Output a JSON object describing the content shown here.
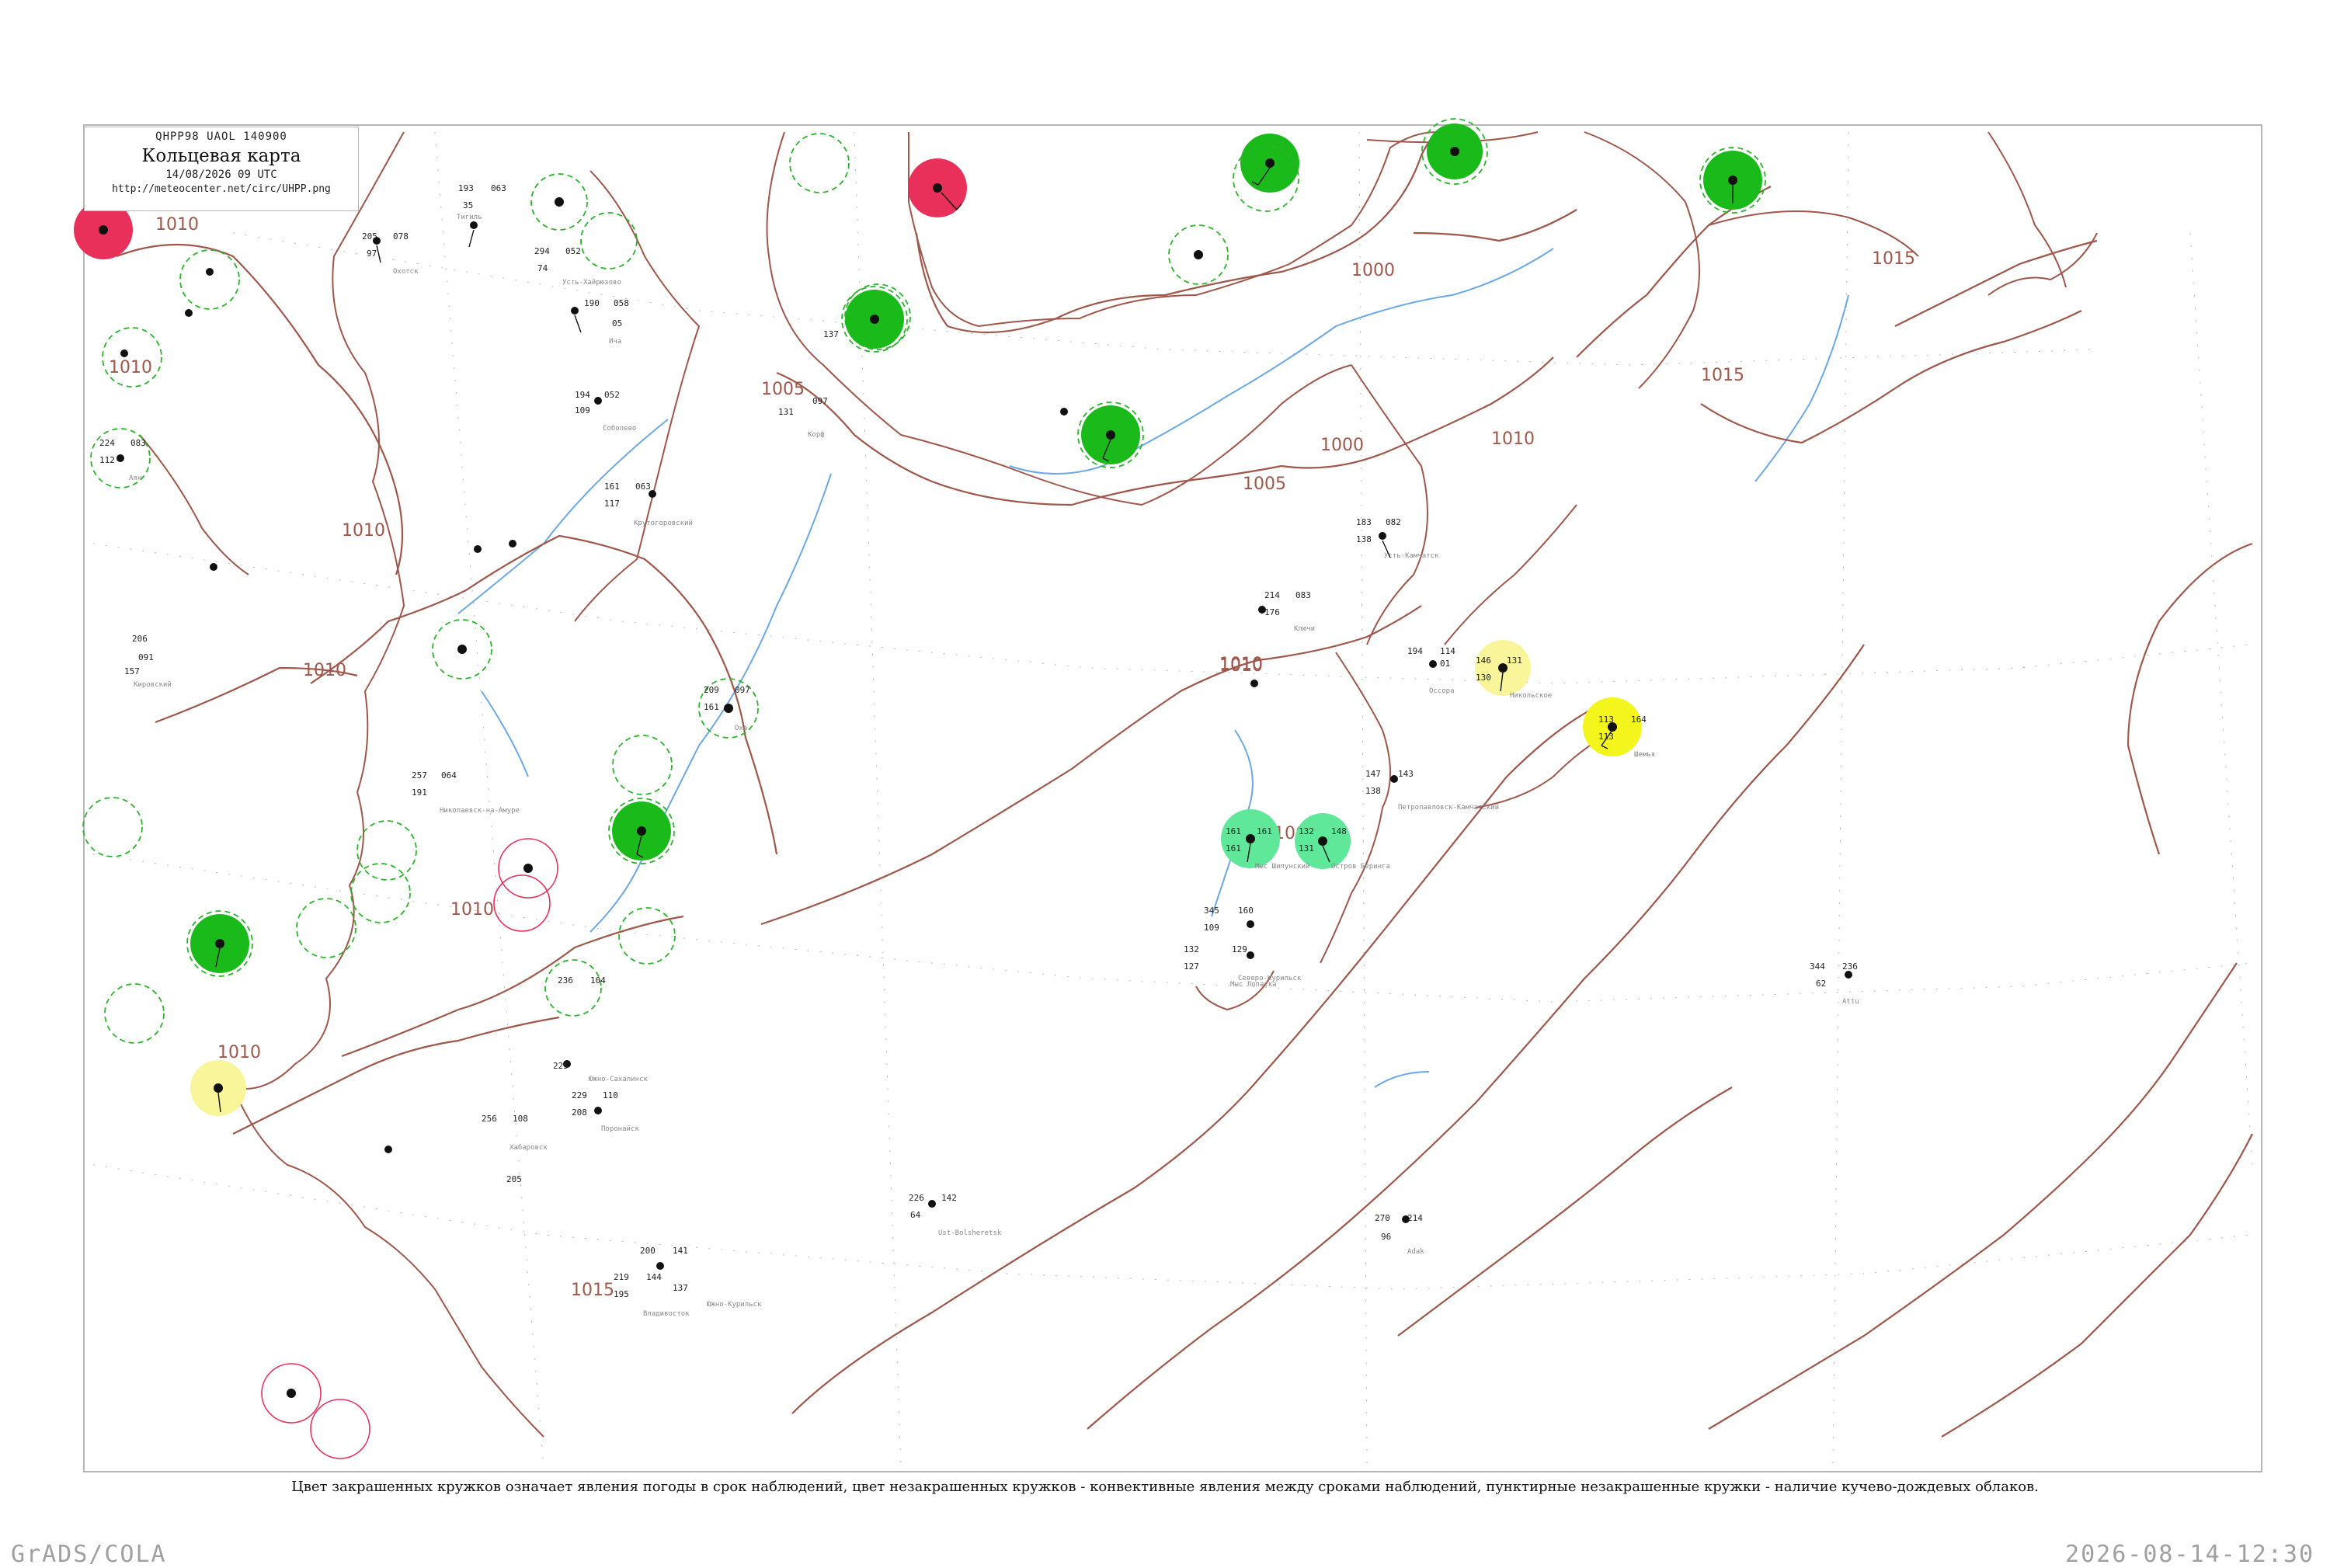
{
  "legend": {
    "code": "QHPP98  UAOL  140900",
    "title": "Кольцевая карта",
    "datetime": "14/08/2026 09 UTC",
    "url": "http://meteocenter.net/circ/UHPP.png"
  },
  "caption": "Цвет закрашенных кружков означает явления погоды в срок наблюдений, цвет незакрашенных кружков - конвективные явления между сроками наблюдений, пунктирные незакрашенные кружки - наличие кучево-дождевых облаков.",
  "footer": {
    "left": "GrADS/COLA",
    "right": "2026-08-14-12:30"
  },
  "colors": {
    "isobar": "#a0574a",
    "river": "#6aa8e8",
    "frame": "#b5b5b5",
    "rain": "#1aba1a",
    "shower_light": "#5fe89a",
    "thunder": "#e8305a",
    "fog": "#f5f51e",
    "fog_light": "#f8f59a",
    "cb_dashed": "#2ab52a"
  },
  "isobar_labels": [
    "1010",
    "1010",
    "1010",
    "1010",
    "1010",
    "1010",
    "1010",
    "1005",
    "1000",
    "1005",
    "1000",
    "1015",
    "1015",
    "1010",
    "1010",
    "1015",
    "1005"
  ],
  "stations": [
    {
      "name": "Тигиль",
      "pressure": "063",
      "temp": "193",
      "code": "35"
    },
    {
      "name": "Усть-Хайрюзово",
      "pressure": "052",
      "temp": "294",
      "code": "74"
    },
    {
      "name": "Ича",
      "pressure": "058",
      "temp": "190",
      "code": "05"
    },
    {
      "name": "Соболево",
      "pressure": "052",
      "temp": "194",
      "code": "109"
    },
    {
      "name": "Крутогоровский",
      "pressure": "063",
      "temp": "161",
      "code": "117"
    },
    {
      "name": "Охотск",
      "pressure": "078",
      "temp": "205",
      "code": "97"
    },
    {
      "name": "Аян",
      "pressure": "083",
      "temp": "224",
      "code": "112"
    },
    {
      "name": "Николаевск-на-Амуре",
      "pressure": "064",
      "temp": "257",
      "code": "191"
    },
    {
      "name": "Усть-Камчатск",
      "pressure": "082",
      "temp": "183",
      "code": "138"
    },
    {
      "name": "Ключи",
      "pressure": "083",
      "temp": "214",
      "code": "176"
    },
    {
      "name": "Петропавловск-Камчатский",
      "pressure": "143",
      "temp": "147",
      "code": "138"
    },
    {
      "name": "Северо-Курильск",
      "pressure": "160",
      "temp": "345",
      "code": "109"
    },
    {
      "name": "Южно-Курильск",
      "pressure": "141",
      "temp": "200",
      "code": "137"
    },
    {
      "name": "Корф",
      "pressure": "097",
      "temp": "137",
      "code": "131"
    },
    {
      "name": "Оссора",
      "pressure": "114",
      "temp": "194",
      "code": "01"
    },
    {
      "name": "Никольское",
      "pressure": "131",
      "temp": "146",
      "code": "130"
    },
    {
      "name": "Шемья",
      "pressure": "164",
      "temp": "113",
      "code": "113"
    },
    {
      "name": "Хабаровск",
      "pressure": "108",
      "temp": "256",
      "code": "205"
    },
    {
      "name": "Владивосток",
      "pressure": "144",
      "temp": "219",
      "code": "195"
    },
    {
      "name": "Южно-Сахалинск",
      "pressure": "104",
      "temp": "236",
      "code": "225"
    },
    {
      "name": "Поронайск",
      "pressure": "110",
      "temp": "229",
      "code": "208"
    },
    {
      "name": "Оха",
      "pressure": "097",
      "temp": "209",
      "code": "161"
    },
    {
      "name": "Мыс Лопатка",
      "pressure": "129",
      "temp": "132",
      "code": "127"
    },
    {
      "name": "Остров Беринга",
      "pressure": "148",
      "temp": "132",
      "code": "131"
    },
    {
      "name": "Мыс Шипунский",
      "pressure": "161",
      "temp": "161",
      "code": "161"
    },
    {
      "name": "Attu",
      "pressure": "236",
      "temp": "344",
      "code": "62"
    },
    {
      "name": "Adak",
      "pressure": "214",
      "temp": "270",
      "code": "96"
    },
    {
      "name": "Ust-Bolsheretsk",
      "pressure": "142",
      "temp": "226",
      "code": "64"
    },
    {
      "name": "Кировский",
      "pressure": "091",
      "temp": "206",
      "code": "157"
    }
  ]
}
